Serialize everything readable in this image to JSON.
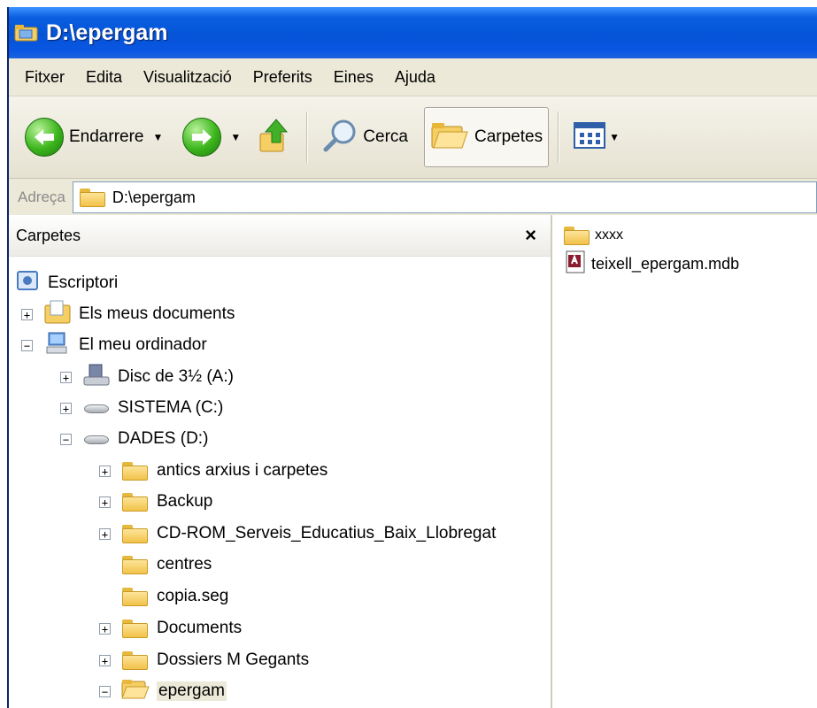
{
  "window": {
    "title": "D:\\epergam"
  },
  "menu": [
    "Fitxer",
    "Edita",
    "Visualització",
    "Preferits",
    "Eines",
    "Ajuda"
  ],
  "toolbar": {
    "back_label": "Endarrere",
    "search_label": "Cerca",
    "folders_label": "Carpetes"
  },
  "address": {
    "label": "Adreça",
    "value": "D:\\epergam"
  },
  "folders_pane": {
    "title": "Carpetes",
    "close": "×",
    "tree": [
      {
        "label": "Escriptori",
        "expander": "",
        "icon": "desktop-icon"
      },
      {
        "label": "Els meus documents",
        "expander": "+",
        "icon": "my-documents-icon"
      },
      {
        "label": "El meu ordinador",
        "expander": "−",
        "icon": "my-computer-icon"
      },
      {
        "label": "Disc de 3½ (A:)",
        "expander": "+",
        "icon": "floppy-drive-icon"
      },
      {
        "label": "SISTEMA (C:)",
        "expander": "+",
        "icon": "hard-drive-icon"
      },
      {
        "label": "DADES (D:)",
        "expander": "−",
        "icon": "hard-drive-icon"
      },
      {
        "label": "antics arxius i carpetes",
        "expander": "+",
        "icon": "folder-icon"
      },
      {
        "label": "Backup",
        "expander": "+",
        "icon": "folder-icon"
      },
      {
        "label": "CD-ROM_Serveis_Educatius_Baix_Llobregat",
        "expander": "+",
        "icon": "folder-icon"
      },
      {
        "label": "centres",
        "expander": "",
        "icon": "folder-icon"
      },
      {
        "label": "copia.seg",
        "expander": "",
        "icon": "folder-icon"
      },
      {
        "label": "Documents",
        "expander": "+",
        "icon": "folder-icon"
      },
      {
        "label": "Dossiers M Gegants",
        "expander": "+",
        "icon": "folder-icon"
      },
      {
        "label": "epergam",
        "expander": "−",
        "icon": "folder-open-icon"
      }
    ]
  },
  "files": [
    {
      "name": "xxxx",
      "icon": "folder-icon"
    },
    {
      "name": "teixell_epergam.mdb",
      "icon": "access-database-icon"
    }
  ],
  "colors": {
    "titlebar": "#0553d6",
    "chrome": "#ece9d8",
    "selection": "#ece9d8"
  }
}
